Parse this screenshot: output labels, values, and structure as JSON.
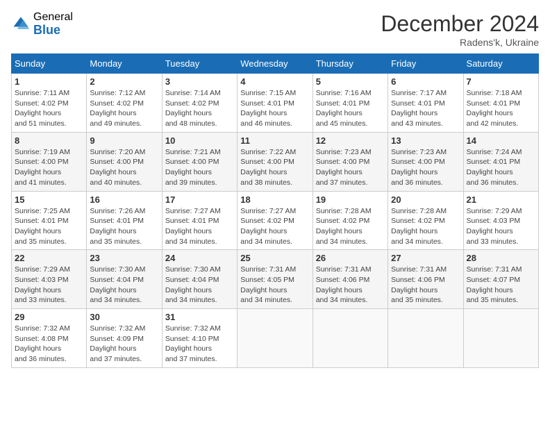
{
  "header": {
    "logo_general": "General",
    "logo_blue": "Blue",
    "month_year": "December 2024",
    "location": "Radens'k, Ukraine"
  },
  "weekdays": [
    "Sunday",
    "Monday",
    "Tuesday",
    "Wednesday",
    "Thursday",
    "Friday",
    "Saturday"
  ],
  "weeks": [
    [
      {
        "day": "1",
        "sunrise": "7:11 AM",
        "sunset": "4:02 PM",
        "daylight": "8 hours and 51 minutes."
      },
      {
        "day": "2",
        "sunrise": "7:12 AM",
        "sunset": "4:02 PM",
        "daylight": "8 hours and 49 minutes."
      },
      {
        "day": "3",
        "sunrise": "7:14 AM",
        "sunset": "4:02 PM",
        "daylight": "8 hours and 48 minutes."
      },
      {
        "day": "4",
        "sunrise": "7:15 AM",
        "sunset": "4:01 PM",
        "daylight": "8 hours and 46 minutes."
      },
      {
        "day": "5",
        "sunrise": "7:16 AM",
        "sunset": "4:01 PM",
        "daylight": "8 hours and 45 minutes."
      },
      {
        "day": "6",
        "sunrise": "7:17 AM",
        "sunset": "4:01 PM",
        "daylight": "8 hours and 43 minutes."
      },
      {
        "day": "7",
        "sunrise": "7:18 AM",
        "sunset": "4:01 PM",
        "daylight": "8 hours and 42 minutes."
      }
    ],
    [
      {
        "day": "8",
        "sunrise": "7:19 AM",
        "sunset": "4:00 PM",
        "daylight": "8 hours and 41 minutes."
      },
      {
        "day": "9",
        "sunrise": "7:20 AM",
        "sunset": "4:00 PM",
        "daylight": "8 hours and 40 minutes."
      },
      {
        "day": "10",
        "sunrise": "7:21 AM",
        "sunset": "4:00 PM",
        "daylight": "8 hours and 39 minutes."
      },
      {
        "day": "11",
        "sunrise": "7:22 AM",
        "sunset": "4:00 PM",
        "daylight": "8 hours and 38 minutes."
      },
      {
        "day": "12",
        "sunrise": "7:23 AM",
        "sunset": "4:00 PM",
        "daylight": "8 hours and 37 minutes."
      },
      {
        "day": "13",
        "sunrise": "7:23 AM",
        "sunset": "4:00 PM",
        "daylight": "8 hours and 36 minutes."
      },
      {
        "day": "14",
        "sunrise": "7:24 AM",
        "sunset": "4:01 PM",
        "daylight": "8 hours and 36 minutes."
      }
    ],
    [
      {
        "day": "15",
        "sunrise": "7:25 AM",
        "sunset": "4:01 PM",
        "daylight": "8 hours and 35 minutes."
      },
      {
        "day": "16",
        "sunrise": "7:26 AM",
        "sunset": "4:01 PM",
        "daylight": "8 hours and 35 minutes."
      },
      {
        "day": "17",
        "sunrise": "7:27 AM",
        "sunset": "4:01 PM",
        "daylight": "8 hours and 34 minutes."
      },
      {
        "day": "18",
        "sunrise": "7:27 AM",
        "sunset": "4:02 PM",
        "daylight": "8 hours and 34 minutes."
      },
      {
        "day": "19",
        "sunrise": "7:28 AM",
        "sunset": "4:02 PM",
        "daylight": "8 hours and 34 minutes."
      },
      {
        "day": "20",
        "sunrise": "7:28 AM",
        "sunset": "4:02 PM",
        "daylight": "8 hours and 34 minutes."
      },
      {
        "day": "21",
        "sunrise": "7:29 AM",
        "sunset": "4:03 PM",
        "daylight": "8 hours and 33 minutes."
      }
    ],
    [
      {
        "day": "22",
        "sunrise": "7:29 AM",
        "sunset": "4:03 PM",
        "daylight": "8 hours and 33 minutes."
      },
      {
        "day": "23",
        "sunrise": "7:30 AM",
        "sunset": "4:04 PM",
        "daylight": "8 hours and 34 minutes."
      },
      {
        "day": "24",
        "sunrise": "7:30 AM",
        "sunset": "4:04 PM",
        "daylight": "8 hours and 34 minutes."
      },
      {
        "day": "25",
        "sunrise": "7:31 AM",
        "sunset": "4:05 PM",
        "daylight": "8 hours and 34 minutes."
      },
      {
        "day": "26",
        "sunrise": "7:31 AM",
        "sunset": "4:06 PM",
        "daylight": "8 hours and 34 minutes."
      },
      {
        "day": "27",
        "sunrise": "7:31 AM",
        "sunset": "4:06 PM",
        "daylight": "8 hours and 35 minutes."
      },
      {
        "day": "28",
        "sunrise": "7:31 AM",
        "sunset": "4:07 PM",
        "daylight": "8 hours and 35 minutes."
      }
    ],
    [
      {
        "day": "29",
        "sunrise": "7:32 AM",
        "sunset": "4:08 PM",
        "daylight": "8 hours and 36 minutes."
      },
      {
        "day": "30",
        "sunrise": "7:32 AM",
        "sunset": "4:09 PM",
        "daylight": "8 hours and 37 minutes."
      },
      {
        "day": "31",
        "sunrise": "7:32 AM",
        "sunset": "4:10 PM",
        "daylight": "8 hours and 37 minutes."
      },
      null,
      null,
      null,
      null
    ]
  ]
}
